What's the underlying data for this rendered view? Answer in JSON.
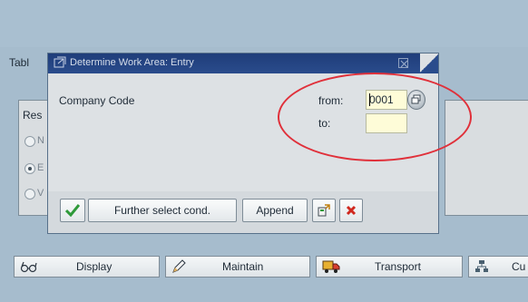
{
  "background": {
    "tabl_label": "Tabl",
    "res_label": "Res",
    "radio_fragments": [
      "N",
      "E",
      "V"
    ]
  },
  "dialog": {
    "title": "Determine Work Area: Entry",
    "company_code_label": "Company Code",
    "from_label": "from:",
    "to_label": "to:",
    "from_value": "0001",
    "to_value": "",
    "toolbar": {
      "further_label": "Further select cond.",
      "append_label": "Append"
    }
  },
  "app_toolbar": {
    "display_label": "Display",
    "maintain_label": "Maintain",
    "transport_label": "Transport",
    "cust_label": "Cu"
  },
  "icons": {
    "title": "dialog-arrow-icon",
    "close": "close-icon",
    "match": "possible-entries-icon",
    "ok": "checkmark-icon",
    "multi": "multiple-selection-icon",
    "cancel": "cancel-icon",
    "display": "glasses-icon",
    "maintain": "pencil-icon",
    "transport": "truck-icon",
    "cust": "structure-icon"
  },
  "colors": {
    "background": "#a6bccd",
    "title_bar": "#1f3d7a",
    "input_bg": "#fefcd8",
    "annotation": "#e0303a",
    "ok_green": "#2f9a3a",
    "cancel_red": "#d0281e"
  }
}
